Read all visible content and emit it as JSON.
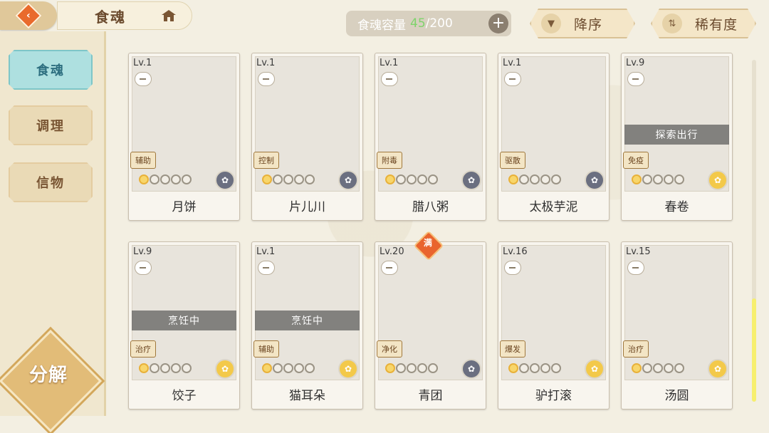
{
  "header": {
    "title": "食魂",
    "capacity_label": "食魂容量",
    "capacity_current": "45",
    "capacity_max": "/200",
    "sort_order_label": "降序",
    "sort_key_label": "稀有度"
  },
  "sidebar": {
    "tabs": [
      {
        "label": "食魂",
        "active": true
      },
      {
        "label": "调理",
        "active": false
      },
      {
        "label": "信物",
        "active": false
      }
    ],
    "decompose_label": "分解"
  },
  "cards": [
    {
      "level": "Lv.1",
      "name": "月饼",
      "role": "辅助",
      "stars_filled": 1,
      "rarity": "blue",
      "status": ""
    },
    {
      "level": "Lv.1",
      "name": "片儿川",
      "role": "控制",
      "stars_filled": 1,
      "rarity": "blue",
      "status": ""
    },
    {
      "level": "Lv.1",
      "name": "腊八粥",
      "role": "附毒",
      "stars_filled": 1,
      "rarity": "blue",
      "status": ""
    },
    {
      "level": "Lv.1",
      "name": "太极芋泥",
      "role": "驱散",
      "stars_filled": 1,
      "rarity": "blue",
      "status": ""
    },
    {
      "level": "Lv.9",
      "name": "春卷",
      "role": "免疫",
      "stars_filled": 1,
      "rarity": "gold",
      "status": "探索出行"
    },
    {
      "level": "Lv.9",
      "name": "饺子",
      "role": "治疗",
      "stars_filled": 1,
      "rarity": "gold",
      "status": "烹饪中"
    },
    {
      "level": "Lv.1",
      "name": "猫耳朵",
      "role": "辅助",
      "stars_filled": 1,
      "rarity": "gold",
      "status": "烹饪中"
    },
    {
      "level": "Lv.20",
      "name": "青团",
      "role": "净化",
      "stars_filled": 1,
      "rarity": "blue",
      "status": "",
      "full_badge": "满"
    },
    {
      "level": "Lv.16",
      "name": "驴打滚",
      "role": "爆发",
      "stars_filled": 1,
      "rarity": "gold",
      "status": ""
    },
    {
      "level": "Lv.15",
      "name": "汤圆",
      "role": "治疗",
      "stars_filled": 1,
      "rarity": "gold",
      "status": ""
    }
  ],
  "colors": {
    "capacity_current": "#7ed36b",
    "active_tab": "#aee0e0",
    "accent": "#e96a2c"
  },
  "icons": {
    "back": "back-arrow-icon",
    "home": "house-icon",
    "add": "plus-icon",
    "sort_order": "triangle-down-icon",
    "sort_key": "sort-arrows-icon"
  }
}
